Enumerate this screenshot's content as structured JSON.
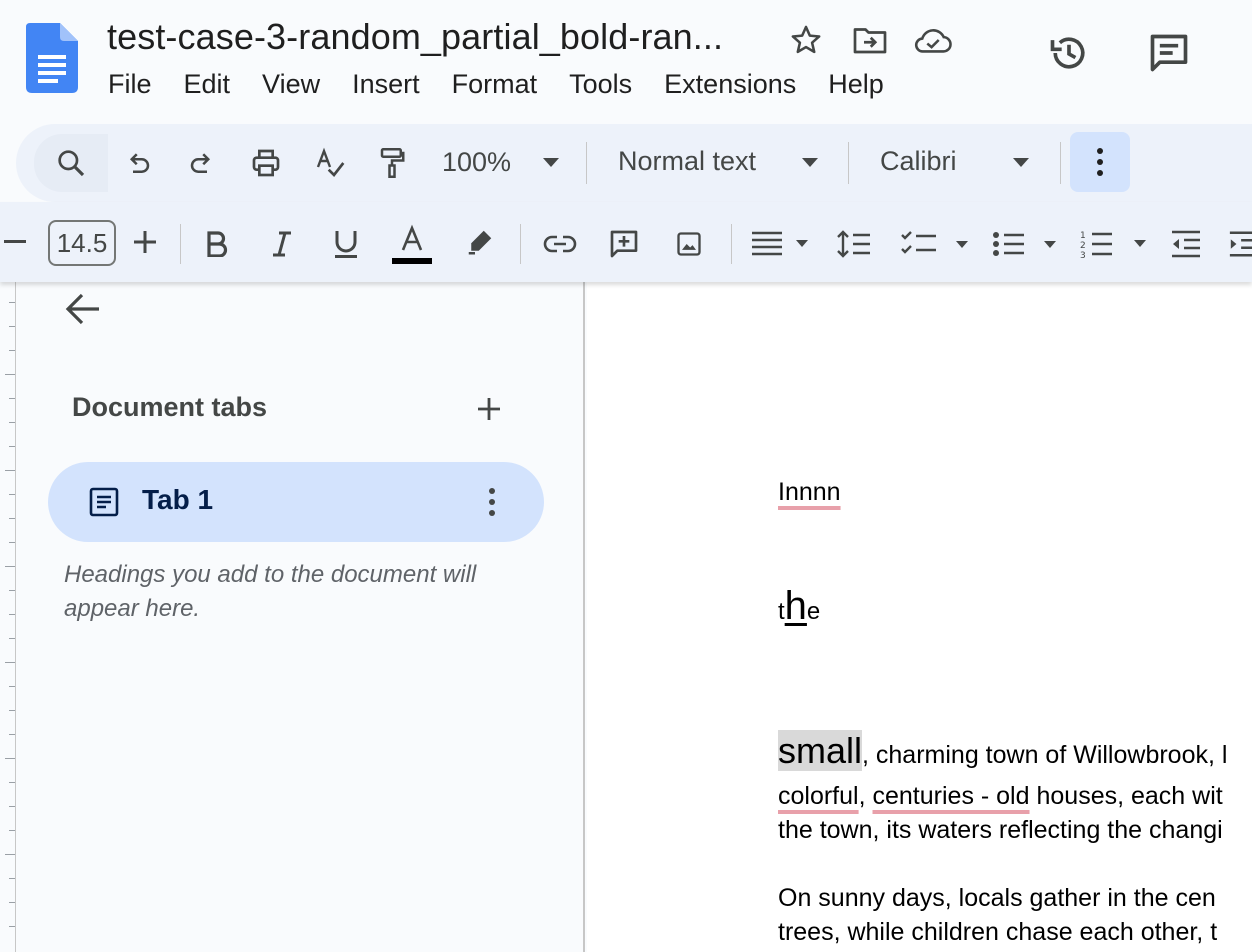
{
  "app": {
    "doc_title": "test-case-3-random_partial_bold-ran...",
    "menu": [
      "File",
      "Edit",
      "View",
      "Insert",
      "Format",
      "Tools",
      "Extensions",
      "Help"
    ]
  },
  "toolbar": {
    "zoom": "100%",
    "style": "Normal text",
    "font": "Calibri",
    "font_size": "14.5"
  },
  "side_panel": {
    "heading": "Document tabs",
    "tabs": [
      {
        "label": "Tab 1"
      }
    ],
    "hint": "Headings you add to the document will appear here."
  },
  "document": {
    "line1": "Innnn",
    "line2": {
      "pre": "t",
      "big": "h",
      "post": "e"
    },
    "para1": {
      "small": "small",
      "line1_rest": ", charming town of Willowbrook, l",
      "colorful": "colorful",
      "comma": ", ",
      "centuries": "centuries - old",
      "line2_rest": " houses, each wit",
      "line3": "the town, its waters reflecting the changi"
    },
    "para2": {
      "line1": "On sunny days, locals gather in the cen",
      "line2": "trees, while children chase each other, t"
    }
  },
  "colors": {
    "accent_blue": "#1a73e8",
    "selected_tab": "#d3e3fd",
    "toolbar_bg": "#edf2fa",
    "spell_underline": "#e8a0aa"
  }
}
